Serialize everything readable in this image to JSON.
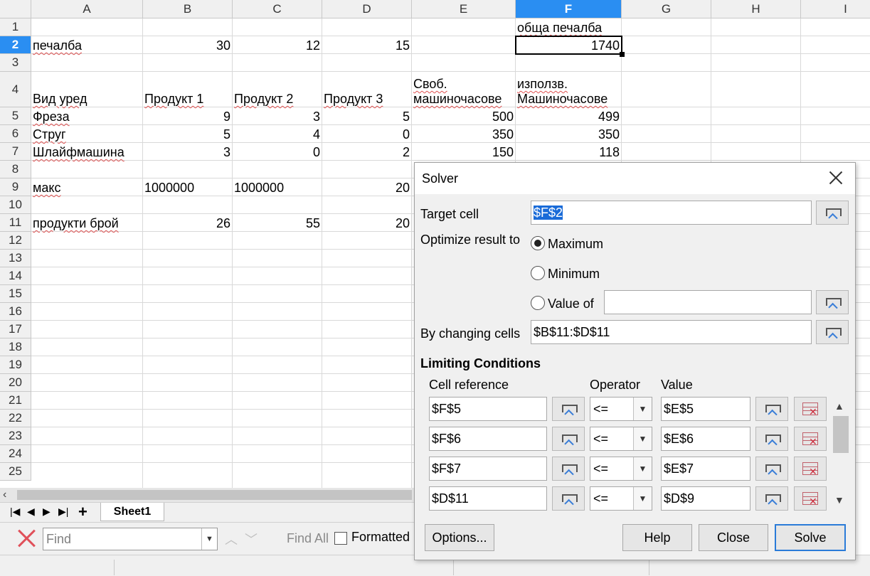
{
  "columns": [
    "A",
    "B",
    "C",
    "D",
    "E",
    "F",
    "G",
    "H",
    "I"
  ],
  "rows": [
    "1",
    "2",
    "3",
    "4",
    "5",
    "6",
    "7",
    "8",
    "9",
    "10",
    "11",
    "12",
    "13",
    "14",
    "15",
    "16",
    "17",
    "18",
    "19",
    "20",
    "21",
    "22",
    "23",
    "24",
    "25"
  ],
  "cells": {
    "F1": "обща печалба",
    "A2": "печалба",
    "B2": "30",
    "C2": "12",
    "D2": "15",
    "F2": "1740",
    "A4": "Вид уред",
    "B4": "Продукт 1",
    "C4": "Продукт 2",
    "D4": "Продукт 3",
    "E4a": "Своб.",
    "E4b": "машиночасове",
    "F4a": "използв.",
    "F4b": "Машиночасове",
    "A5": "Фреза",
    "B5": "9",
    "C5": "3",
    "D5": "5",
    "E5": "500",
    "F5": "499",
    "A6": "Струг",
    "B6": "5",
    "C6": "4",
    "D6": "0",
    "E6": "350",
    "F6": "350",
    "A7": "Шлайфмашина",
    "B7": "3",
    "C7": "0",
    "D7": "2",
    "E7": "150",
    "F7": "118",
    "A9": "макс",
    "B9": "1000000",
    "C9": "1000000",
    "D9": "20",
    "A11": "продукти брой",
    "B11": "26",
    "C11": "55",
    "D11": "20"
  },
  "tabs": {
    "sheet1": "Sheet1"
  },
  "findbar": {
    "placeholder": "Find",
    "find_all": "Find All",
    "formatted": "Formatted"
  },
  "dialog": {
    "title": "Solver",
    "target_cell_label": "Target cell",
    "target_cell_value": "$F$2",
    "optimize_label": "Optimize result to",
    "opt_maximum": "Maximum",
    "opt_minimum": "Minimum",
    "opt_value_of": "Value of",
    "value_of_field": "",
    "changing_cells_label": "By changing cells",
    "changing_cells_value": "$B$11:$D$11",
    "limiting_conditions": "Limiting Conditions",
    "col_cell_reference": "Cell reference",
    "col_operator": "Operator",
    "col_value": "Value",
    "conditions": [
      {
        "ref": "$F$5",
        "op": "<=",
        "value": "$E$5"
      },
      {
        "ref": "$F$6",
        "op": "<=",
        "value": "$E$6"
      },
      {
        "ref": "$F$7",
        "op": "<=",
        "value": "$E$7"
      },
      {
        "ref": "$D$11",
        "op": "<=",
        "value": "$D$9"
      }
    ],
    "buttons": {
      "options": "Options...",
      "help": "Help",
      "close": "Close",
      "solve": "Solve"
    }
  },
  "colors": {
    "selection": "#2a8ef2",
    "spell_underline": "#e05050",
    "default_button_border": "#2a7bd8"
  }
}
